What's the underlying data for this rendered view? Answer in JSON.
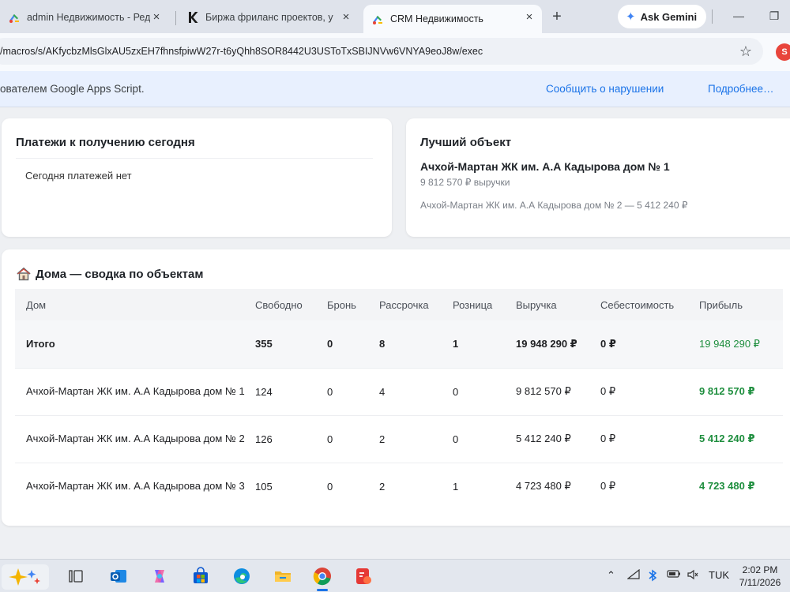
{
  "browser": {
    "tabs": [
      {
        "title": "admin Недвижимость - Ред",
        "favicon": "apps-script-icon",
        "active": false
      },
      {
        "title": "Биржа фриланс проектов, у",
        "favicon": "kwork-k-icon",
        "active": false
      },
      {
        "title": "CRM Недвижимость",
        "favicon": "apps-script-icon",
        "active": true
      }
    ],
    "new_tab_symbol": "+",
    "gemini_label": "Ask Gemini",
    "url": "/macros/s/AKfycbzMlsGlxAU5zxEH7fhnsfpiwW27r-t6yQhh8SOR8442U3USToTxSBIJNVw6VNYA9eoJ8w/exec",
    "profile_initial": "S"
  },
  "gas_banner": {
    "message": "ователем Google Apps Script.",
    "report_link": "Сообщить о нарушении",
    "more_link": "Подробнее…"
  },
  "payments": {
    "title": "Платежи к получению сегодня",
    "empty_text": "Сегодня платежей нет"
  },
  "best_object": {
    "title": "Лучший объект",
    "name": "Ачхой-Мартан ЖК им. А.А Кадырова дом № 1",
    "revenue_text": "9 812 570 ₽ выручки",
    "runner_up": "Ачхой-Мартан ЖК им. А.А Кадырова дом № 2 — 5 412 240 ₽"
  },
  "summary": {
    "title": "Дома — сводка по объектам",
    "columns": [
      "Дом",
      "Свободно",
      "Бронь",
      "Рассрочка",
      "Розница",
      "Выручка",
      "Себестоимость",
      "Прибыль"
    ],
    "rows": [
      {
        "name": "Итого",
        "free": "355",
        "reserved": "0",
        "installment": "8",
        "retail": "1",
        "revenue": "19 948 290 ₽",
        "cost": "0 ₽",
        "profit": "19 948 290 ₽"
      },
      {
        "name": "Ачхой-Мартан ЖК им. А.А Кадырова дом № 1",
        "free": "124",
        "reserved": "0",
        "installment": "4",
        "retail": "0",
        "revenue": "9 812 570 ₽",
        "cost": "0 ₽",
        "profit": "9 812 570 ₽"
      },
      {
        "name": "Ачхой-Мартан ЖК им. А.А Кадырова дом № 2",
        "free": "126",
        "reserved": "0",
        "installment": "2",
        "retail": "0",
        "revenue": "5 412 240 ₽",
        "cost": "0 ₽",
        "profit": "5 412 240 ₽"
      },
      {
        "name": "Ачхой-Мартан ЖК им. А.А Кадырова дом № 3",
        "free": "105",
        "reserved": "0",
        "installment": "2",
        "retail": "1",
        "revenue": "4 723 480 ₽",
        "cost": "0 ₽",
        "profit": "4 723 480 ₽"
      }
    ]
  },
  "taskbar": {
    "language": "TUK",
    "time": "2:02 PM",
    "date": "7/11/2026"
  },
  "colors": {
    "profit_green": "#1e8e3e",
    "link_blue": "#1a73e8",
    "banner_bg": "#e8f0fe"
  }
}
